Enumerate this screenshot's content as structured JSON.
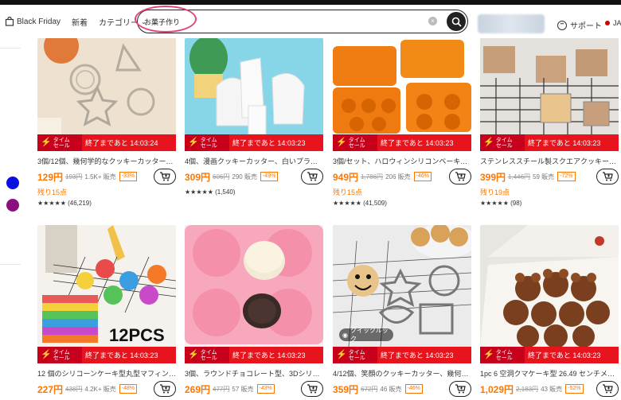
{
  "header": {
    "logo_label": "Black Friday",
    "nav": [
      "新着",
      "カテゴリー"
    ],
    "search_value": "お菓子作り",
    "support_label": "サポート",
    "lang_label": "JA"
  },
  "colors": {
    "accent": "#fb7701",
    "timer_red": "#e8141d",
    "ring_pink": "#e0457a"
  },
  "sidebar": {
    "dots": [
      "#0a10e0",
      "#8a1080"
    ]
  },
  "row1": [
    {
      "title": "3個/12個、幾何学的なクッキーカッター、ステ…",
      "price": "129円",
      "old": "193円",
      "sold": "1.5K+ 販売",
      "discount": "-33%",
      "stock": "残り15点",
      "stars": "★★★★★",
      "reviews": "(46,219)",
      "countdown": "終了まであと 14:03:24"
    },
    {
      "title": "4個、漫画クッキーカッター、白いプラスチッキ…",
      "price": "309円",
      "old": "606円",
      "sold": "290 販売",
      "discount": "-49%",
      "stock": "",
      "stars": "★★★★★",
      "reviews": "(1,540)",
      "countdown": "終了まであと 14:03:23"
    },
    {
      "title": "3個/セット、ハロウィンシリコンベーキングモール…",
      "price": "949円",
      "old": "1,786円",
      "sold": "206 販売",
      "discount": "-46%",
      "stock": "残り15点",
      "stars": "★★★★★",
      "reviews": "(41,509)",
      "countdown": "終了まであと 14:03:23"
    },
    {
      "title": "ステンレススチール製スクエアクッキーカッターセ…",
      "price": "399円",
      "old": "1,446円",
      "sold": "59 販売",
      "discount": "-72%",
      "stock": "残り19点",
      "stars": "★★★★★",
      "reviews": "(98)",
      "countdown": "終了まであと 14:03:23"
    }
  ],
  "row2": [
    {
      "title": "12 個のシリコーンケーキ型丸型マフィンカップケ…",
      "price": "227円",
      "old": "438円",
      "sold": "4.2K+ 販売",
      "discount": "-48%",
      "countdown": "終了まであと 14:03:23",
      "img_caption": "12PCS"
    },
    {
      "title": "3個、ラウンドチョコレート型、3Dシリコン型、ブ…",
      "price": "269円",
      "old": "477円",
      "sold": "57 販売",
      "discount": "-43%",
      "countdown": "終了まであと 14:03:23"
    },
    {
      "title": "4/12個、笑顔のクッキーカッター、幾何学的…",
      "price": "359円",
      "old": "672円",
      "sold": "46 販売",
      "discount": "-46%",
      "countdown": "終了まであと 14:03:23",
      "quick_look": "クイックルック"
    },
    {
      "title": "1pc 6 空洞クマケーキ型 26.49 センチメートル…",
      "price": "1,029円",
      "old": "2,183円",
      "sold": "43 販売",
      "discount": "-52%",
      "countdown": "終了まであと 14:03:23"
    }
  ],
  "timer_badge": "タイム\nセール"
}
